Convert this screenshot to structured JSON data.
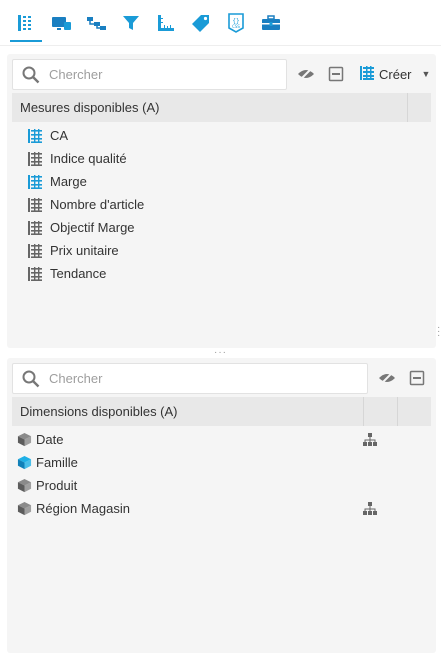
{
  "toolbar": {
    "tools": [
      {
        "icon": "measures-icon",
        "active": true
      },
      {
        "icon": "display-icon"
      },
      {
        "icon": "hierarchy-icon"
      },
      {
        "icon": "filter-icon"
      },
      {
        "icon": "ruler-icon"
      },
      {
        "icon": "tag-icon"
      },
      {
        "icon": "css-file-icon"
      },
      {
        "icon": "toolbox-icon"
      }
    ]
  },
  "measures": {
    "search_placeholder": "Chercher",
    "create_label": "Créer",
    "header": "Mesures disponibles (A)",
    "items": [
      {
        "label": "CA",
        "highlight": true
      },
      {
        "label": "Indice qualité",
        "highlight": false
      },
      {
        "label": "Marge",
        "highlight": true
      },
      {
        "label": "Nombre d'article",
        "highlight": false
      },
      {
        "label": "Objectif Marge",
        "highlight": false
      },
      {
        "label": "Prix unitaire",
        "highlight": false
      },
      {
        "label": "Tendance",
        "highlight": false
      }
    ]
  },
  "dimensions": {
    "search_placeholder": "Chercher",
    "header": "Dimensions disponibles (A)",
    "items": [
      {
        "label": "Date",
        "highlight": false,
        "hierarchy": true
      },
      {
        "label": "Famille",
        "highlight": true,
        "hierarchy": false
      },
      {
        "label": "Produit",
        "highlight": false,
        "hierarchy": false
      },
      {
        "label": "Région Magasin",
        "highlight": false,
        "hierarchy": true
      }
    ]
  },
  "colors": {
    "accent": "#1a9bd7",
    "icon_gray": "#666666",
    "panel_bg": "#f5f5f5",
    "header_bg": "#e8e8e8"
  }
}
